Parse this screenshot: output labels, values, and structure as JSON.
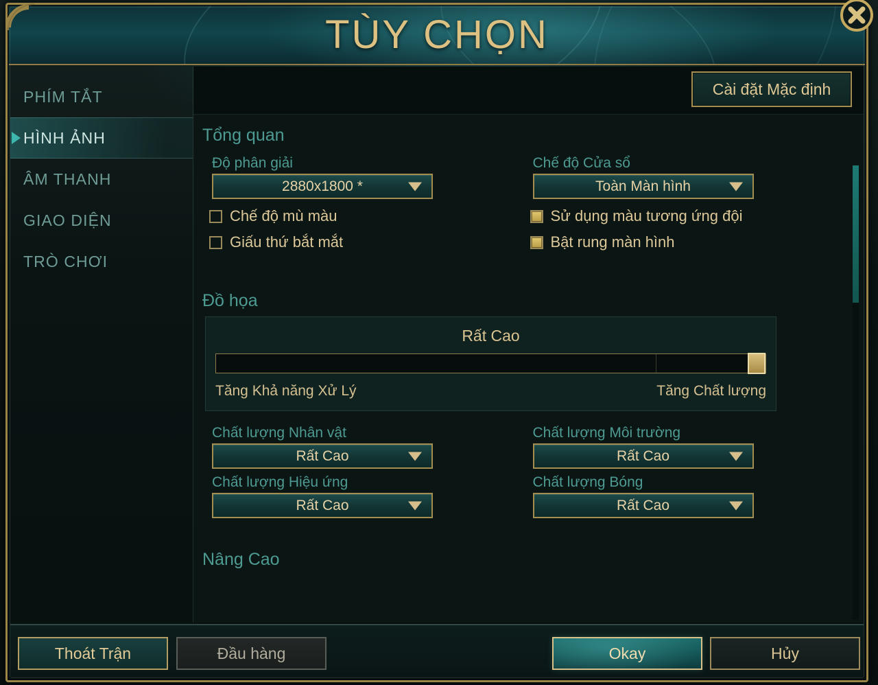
{
  "window": {
    "title": "TÙY CHỌN",
    "close_icon": "close-x-icon"
  },
  "sidebar": {
    "items": [
      {
        "label": "PHÍM TẮT",
        "active": false
      },
      {
        "label": "HÌNH ẢNH",
        "active": true
      },
      {
        "label": "ÂM THANH",
        "active": false
      },
      {
        "label": "GIAO DIỆN",
        "active": false
      },
      {
        "label": "TRÒ CHƠI",
        "active": false
      }
    ]
  },
  "toolbar": {
    "defaults_label": "Cài đặt Mặc định"
  },
  "sections": {
    "overview": {
      "heading": "Tổng quan",
      "resolution_label": "Độ phân giải",
      "resolution_value": "2880x1800 *",
      "window_mode_label": "Chế độ Cửa sổ",
      "window_mode_value": "Toàn Màn hình",
      "colorblind_label": "Chế độ mù màu",
      "colorblind_checked": false,
      "hide_eyecandy_label": "Giấu thứ bắt mắt",
      "hide_eyecandy_checked": false,
      "team_colors_label": "Sử dụng màu tương ứng đội",
      "team_colors_checked": true,
      "screen_shake_label": "Bật rung màn hình",
      "screen_shake_checked": true
    },
    "graphics": {
      "heading": "Đồ họa",
      "quality_preset": "Rất Cao",
      "slider_percent": 100,
      "left_end_label": "Tăng Khả năng Xử Lý",
      "right_end_label": "Tăng Chất lượng",
      "character_quality_label": "Chất lượng Nhân vật",
      "character_quality_value": "Rất Cao",
      "environment_quality_label": "Chất lượng Môi trường",
      "environment_quality_value": "Rất Cao",
      "effects_quality_label": "Chất lượng Hiệu ứng",
      "effects_quality_value": "Rất Cao",
      "shadow_quality_label": "Chất lượng Bóng",
      "shadow_quality_value": "Rất Cao"
    },
    "advanced": {
      "heading": "Nâng Cao"
    }
  },
  "footer": {
    "exit_label": "Thoát Trận",
    "surrender_label": "Đầu hàng",
    "okay_label": "Okay",
    "cancel_label": "Hủy"
  },
  "colors": {
    "gold": "#d9c08a",
    "teal_accent": "#3fb6ad",
    "section_heading": "#4d9b92",
    "panel_bg": "#0b1513"
  }
}
